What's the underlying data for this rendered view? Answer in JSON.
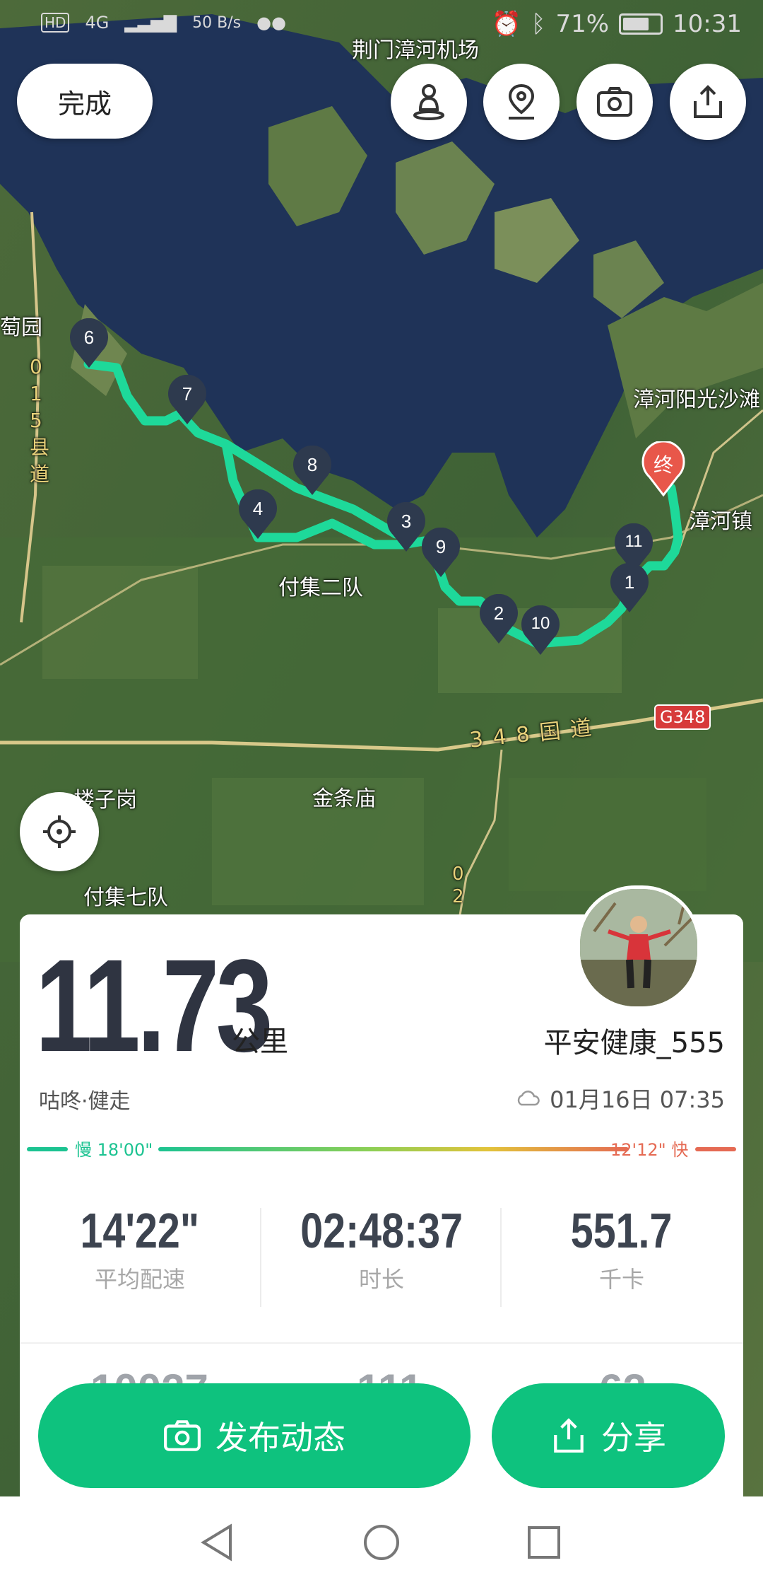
{
  "status_bar": {
    "network": "4G",
    "speed": "50 B/s",
    "battery": "71%",
    "battery_level": 0.71,
    "time": "10:31"
  },
  "header": {
    "done_label": "完成"
  },
  "map": {
    "labels": {
      "airport": "荆门漳河机场",
      "grape": "萄园",
      "county_road": "015县道",
      "sunshine": "漳河阳光沙滩",
      "town": "漳河镇",
      "fuji2": "付集二队",
      "national_road": "348国道",
      "g348": "G348",
      "louzigang": "楼子岗",
      "jintiaomiao": "金条庙",
      "fuji7": "付集七队",
      "road_02": "02"
    },
    "end_marker": "终",
    "markers": [
      "1",
      "2",
      "3",
      "4",
      "6",
      "7",
      "8",
      "9",
      "10",
      "11"
    ]
  },
  "summary": {
    "distance": "11.73",
    "distance_unit": "公里",
    "username": "平安健康_555",
    "activity": "咕咚·健走",
    "datetime": "01月16日 07:35",
    "pace_slow": "慢 18'00\"",
    "pace_fast": "12'12\" 快",
    "stats": [
      {
        "value": "14'22\"",
        "label": "平均配速"
      },
      {
        "value": "02:48:37",
        "label": "时长"
      },
      {
        "value": "551.7",
        "label": "千卡"
      }
    ],
    "stats_partial": [
      "10027",
      "111",
      "62"
    ]
  },
  "actions": {
    "publish_label": "发布动态",
    "share_label": "分享"
  },
  "colors": {
    "accent": "#0ec27e",
    "route": "#1ed99a",
    "end_marker": "#e8574a",
    "slow": "#1cc391",
    "fast": "#e56a53"
  }
}
